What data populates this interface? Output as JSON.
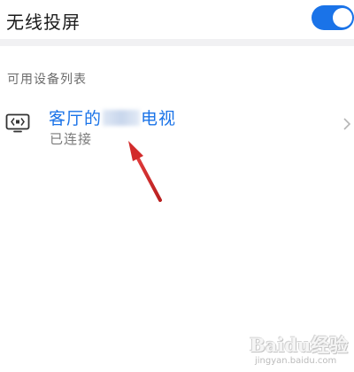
{
  "header": {
    "title": "无线投屏",
    "toggle_state": "on",
    "accent_color": "#1a73e8"
  },
  "available_devices": {
    "section_title": "可用设备列表",
    "items": [
      {
        "icon": "tv-cast-icon",
        "name_prefix": "客厅的",
        "name_suffix": "电视",
        "status": "已连接"
      }
    ]
  },
  "annotation": {
    "arrow_color": "#d22b2b"
  },
  "watermark": {
    "text": "Baidu经验",
    "subtext": "jingyan.baidu.com"
  }
}
